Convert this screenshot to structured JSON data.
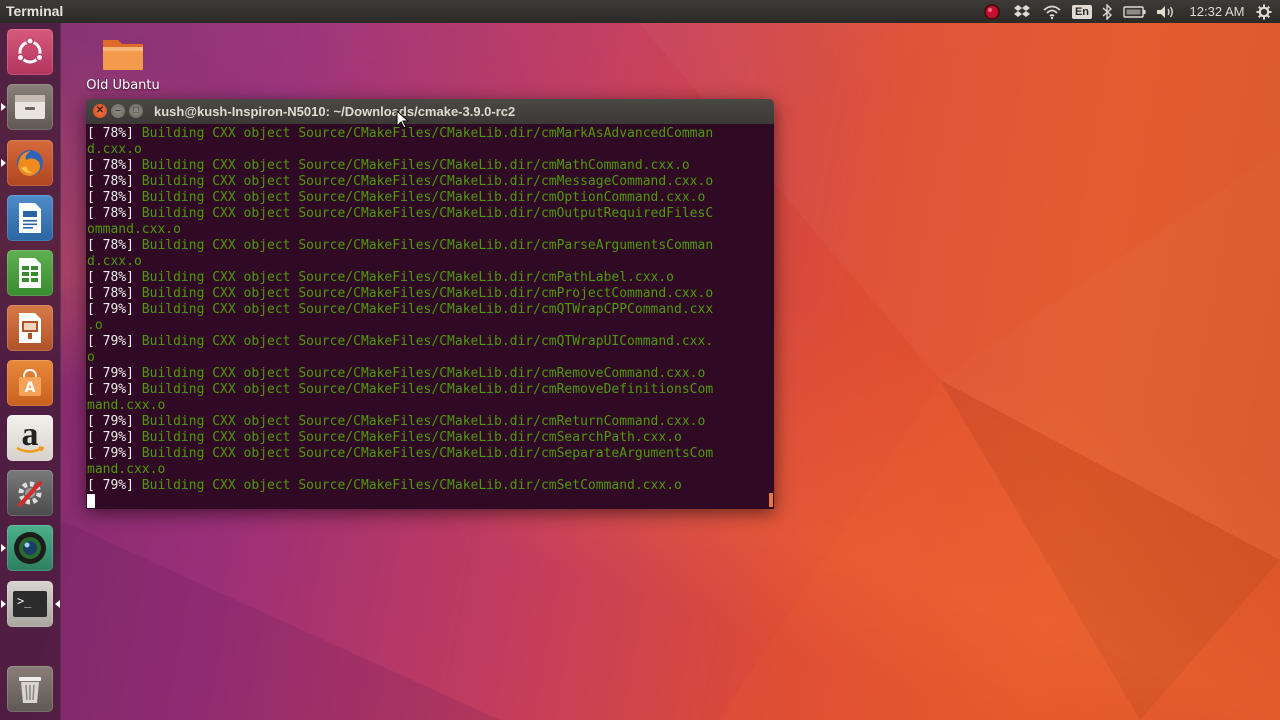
{
  "top_panel": {
    "app_title": "Terminal",
    "keyboard_layout": "En",
    "clock": "12:32 AM",
    "tray_icons": [
      "record-indicator-icon",
      "dropbox-icon",
      "wifi-icon",
      "keyboard-layout-icon",
      "bluetooth-icon",
      "battery-icon",
      "volume-icon",
      "clock",
      "gear-icon"
    ]
  },
  "launcher": {
    "items": [
      {
        "name": "ubuntu-dash-icon"
      },
      {
        "name": "files-icon"
      },
      {
        "name": "firefox-icon"
      },
      {
        "name": "libreoffice-writer-icon"
      },
      {
        "name": "libreoffice-calc-icon"
      },
      {
        "name": "libreoffice-impress-icon"
      },
      {
        "name": "ubuntu-software-icon"
      },
      {
        "name": "amazon-icon"
      },
      {
        "name": "system-settings-icon"
      },
      {
        "name": "camera-app-icon"
      },
      {
        "name": "terminal-icon"
      },
      {
        "name": "trash-icon"
      }
    ],
    "amazon_letter": "a",
    "terminal_prompt_glyph": ">_"
  },
  "desktop": {
    "icon_label": "Old Ubantu"
  },
  "terminal": {
    "title": "kush@kush-Inspiron-N5010: ~/Downloads/cmake-3.9.0-rc2",
    "lines": [
      {
        "pct": "[ 78%]",
        "msg": " Building CXX object Source/CMakeFiles/CMakeLib.dir/cmMarkAsAdvancedComman"
      },
      {
        "pct": "",
        "msg": "d.cxx.o"
      },
      {
        "pct": "[ 78%]",
        "msg": " Building CXX object Source/CMakeFiles/CMakeLib.dir/cmMathCommand.cxx.o"
      },
      {
        "pct": "[ 78%]",
        "msg": " Building CXX object Source/CMakeFiles/CMakeLib.dir/cmMessageCommand.cxx.o"
      },
      {
        "pct": "[ 78%]",
        "msg": " Building CXX object Source/CMakeFiles/CMakeLib.dir/cmOptionCommand.cxx.o"
      },
      {
        "pct": "[ 78%]",
        "msg": " Building CXX object Source/CMakeFiles/CMakeLib.dir/cmOutputRequiredFilesC"
      },
      {
        "pct": "",
        "msg": "ommand.cxx.o"
      },
      {
        "pct": "[ 78%]",
        "msg": " Building CXX object Source/CMakeFiles/CMakeLib.dir/cmParseArgumentsComman"
      },
      {
        "pct": "",
        "msg": "d.cxx.o"
      },
      {
        "pct": "[ 78%]",
        "msg": " Building CXX object Source/CMakeFiles/CMakeLib.dir/cmPathLabel.cxx.o"
      },
      {
        "pct": "[ 78%]",
        "msg": " Building CXX object Source/CMakeFiles/CMakeLib.dir/cmProjectCommand.cxx.o"
      },
      {
        "pct": "[ 79%]",
        "msg": " Building CXX object Source/CMakeFiles/CMakeLib.dir/cmQTWrapCPPCommand.cxx"
      },
      {
        "pct": "",
        "msg": ".o"
      },
      {
        "pct": "[ 79%]",
        "msg": " Building CXX object Source/CMakeFiles/CMakeLib.dir/cmQTWrapUICommand.cxx."
      },
      {
        "pct": "",
        "msg": "o"
      },
      {
        "pct": "[ 79%]",
        "msg": " Building CXX object Source/CMakeFiles/CMakeLib.dir/cmRemoveCommand.cxx.o"
      },
      {
        "pct": "[ 79%]",
        "msg": " Building CXX object Source/CMakeFiles/CMakeLib.dir/cmRemoveDefinitionsCom"
      },
      {
        "pct": "",
        "msg": "mand.cxx.o"
      },
      {
        "pct": "[ 79%]",
        "msg": " Building CXX object Source/CMakeFiles/CMakeLib.dir/cmReturnCommand.cxx.o"
      },
      {
        "pct": "[ 79%]",
        "msg": " Building CXX object Source/CMakeFiles/CMakeLib.dir/cmSearchPath.cxx.o"
      },
      {
        "pct": "[ 79%]",
        "msg": " Building CXX object Source/CMakeFiles/CMakeLib.dir/cmSeparateArgumentsCom"
      },
      {
        "pct": "",
        "msg": "mand.cxx.o"
      },
      {
        "pct": "[ 79%]",
        "msg": " Building CXX object Source/CMakeFiles/CMakeLib.dir/cmSetCommand.cxx.o"
      }
    ]
  },
  "colors": {
    "terminal_bg": "#300a24",
    "terminal_green": "#4e9a06",
    "close_button": "#e65b2f"
  }
}
